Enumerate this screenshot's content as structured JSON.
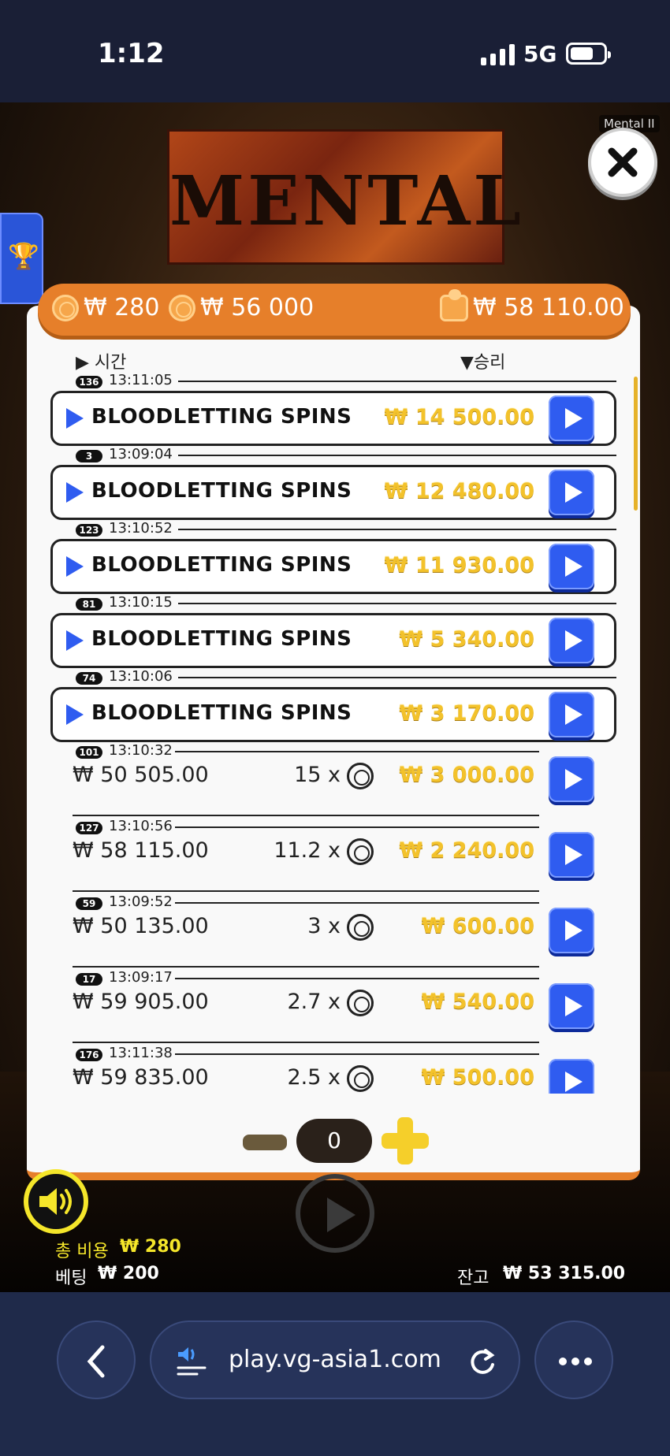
{
  "status": {
    "time": "1:12",
    "network": "5G"
  },
  "game": {
    "logo_text": "MENTAL",
    "tag": "Mental II",
    "topbar": {
      "coin1": "₩ 280",
      "coin2": "₩ 56 000",
      "balance": "₩ 58 110.00"
    },
    "columns": {
      "time": "시간",
      "win": "승리"
    },
    "rows": [
      {
        "badge": "136",
        "time": "13:11:05",
        "label": "BLOODLETTING SPINS",
        "amount": "₩ 14 500.00"
      },
      {
        "badge": "3",
        "time": "13:09:04",
        "label": "BLOODLETTING SPINS",
        "amount": "₩ 12 480.00"
      },
      {
        "badge": "123",
        "time": "13:10:52",
        "label": "BLOODLETTING SPINS",
        "amount": "₩ 11 930.00"
      },
      {
        "badge": "81",
        "time": "13:10:15",
        "label": "BLOODLETTING SPINS",
        "amount": "₩ 5 340.00"
      },
      {
        "badge": "74",
        "time": "13:10:06",
        "label": "BLOODLETTING SPINS",
        "amount": "₩ 3 170.00"
      },
      {
        "badge": "101",
        "time": "13:10:32",
        "bet": "₩ 50 505.00",
        "mult": "15 x",
        "amount": "₩ 3 000.00"
      },
      {
        "badge": "127",
        "time": "13:10:56",
        "bet": "₩ 58 115.00",
        "mult": "11.2 x",
        "amount": "₩ 2 240.00"
      },
      {
        "badge": "59",
        "time": "13:09:52",
        "bet": "₩ 50 135.00",
        "mult": "3 x",
        "amount": "₩ 600.00"
      },
      {
        "badge": "17",
        "time": "13:09:17",
        "bet": "₩ 59 905.00",
        "mult": "2.7 x",
        "amount": "₩ 540.00"
      },
      {
        "badge": "176",
        "time": "13:11:38",
        "bet": "₩ 59 835.00",
        "mult": "2.5 x",
        "amount": "₩ 500.00"
      }
    ],
    "counter": "0",
    "footer": {
      "total_label": "총 비용",
      "total_value": "₩ 280",
      "bet_label": "베팅",
      "bet_value": "₩ 200",
      "balance_label": "잔고",
      "balance_value": "₩ 53 315.00"
    }
  },
  "browser": {
    "url": "play.vg-asia1.com"
  }
}
